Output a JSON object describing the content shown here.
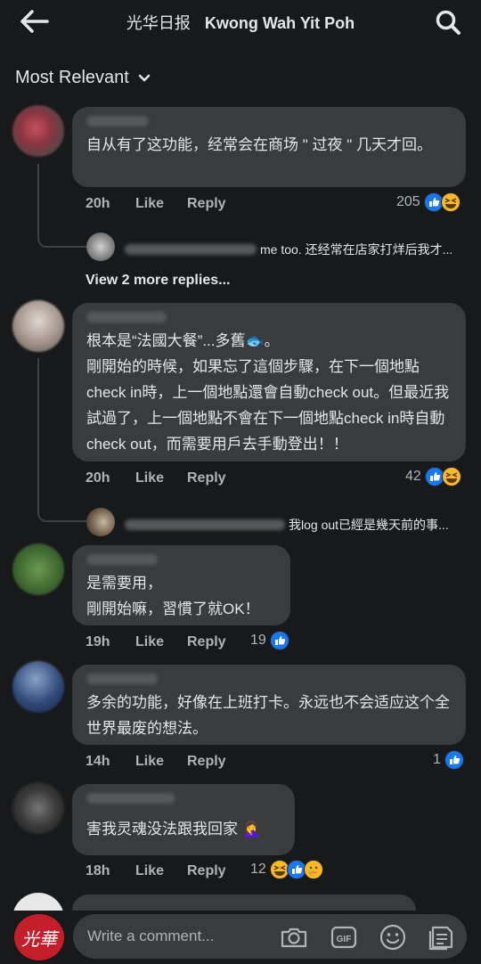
{
  "header": {
    "title_zh": "光华日报",
    "title_en": "Kwong Wah Yit Poh"
  },
  "sort": {
    "label": "Most Relevant"
  },
  "comments": [
    {
      "text": "自从有了这功能，经常会在商场 \" 过夜 \" 几天才回。",
      "time": "20h",
      "like": "Like",
      "reply": "Reply",
      "reactions": "205",
      "reply_preview": "me too. 还经常在店家打烊后我才...",
      "more_replies": "View 2 more replies..."
    },
    {
      "text": "根本是“法國大餐”...多舊🐟。\n剛開始的時候，如果忘了這個步驟，在下一個地點check in時，上一個地點還會自動check out。但最近我試過了，上一個地點不會在下一個地點check in時自動check out，而需要用戶去手動登出！！",
      "time": "20h",
      "like": "Like",
      "reply": "Reply",
      "reactions": "42",
      "reply_preview": "我log out已經是幾天前的事..."
    },
    {
      "text": "是需要用，\n剛開始嘛，習慣了就OK！",
      "time": "19h",
      "like": "Like",
      "reply": "Reply",
      "reactions": "19"
    },
    {
      "text": "多余的功能，好像在上班打卡。永远也不会适应这个全世界最废的想法。",
      "time": "14h",
      "like": "Like",
      "reply": "Reply",
      "reactions": "1"
    },
    {
      "text": "害我灵魂没法跟我回家 🤦‍♀️",
      "time": "18h",
      "like": "Like",
      "reply": "Reply",
      "reactions": "12"
    }
  ],
  "composer": {
    "placeholder": "Write a comment...",
    "logo_text": "光華"
  },
  "colors": {
    "background": "#18191a",
    "bubble": "#3a3b3c",
    "like_blue": "#1877f2",
    "haha_yellow": "#f7b928"
  }
}
